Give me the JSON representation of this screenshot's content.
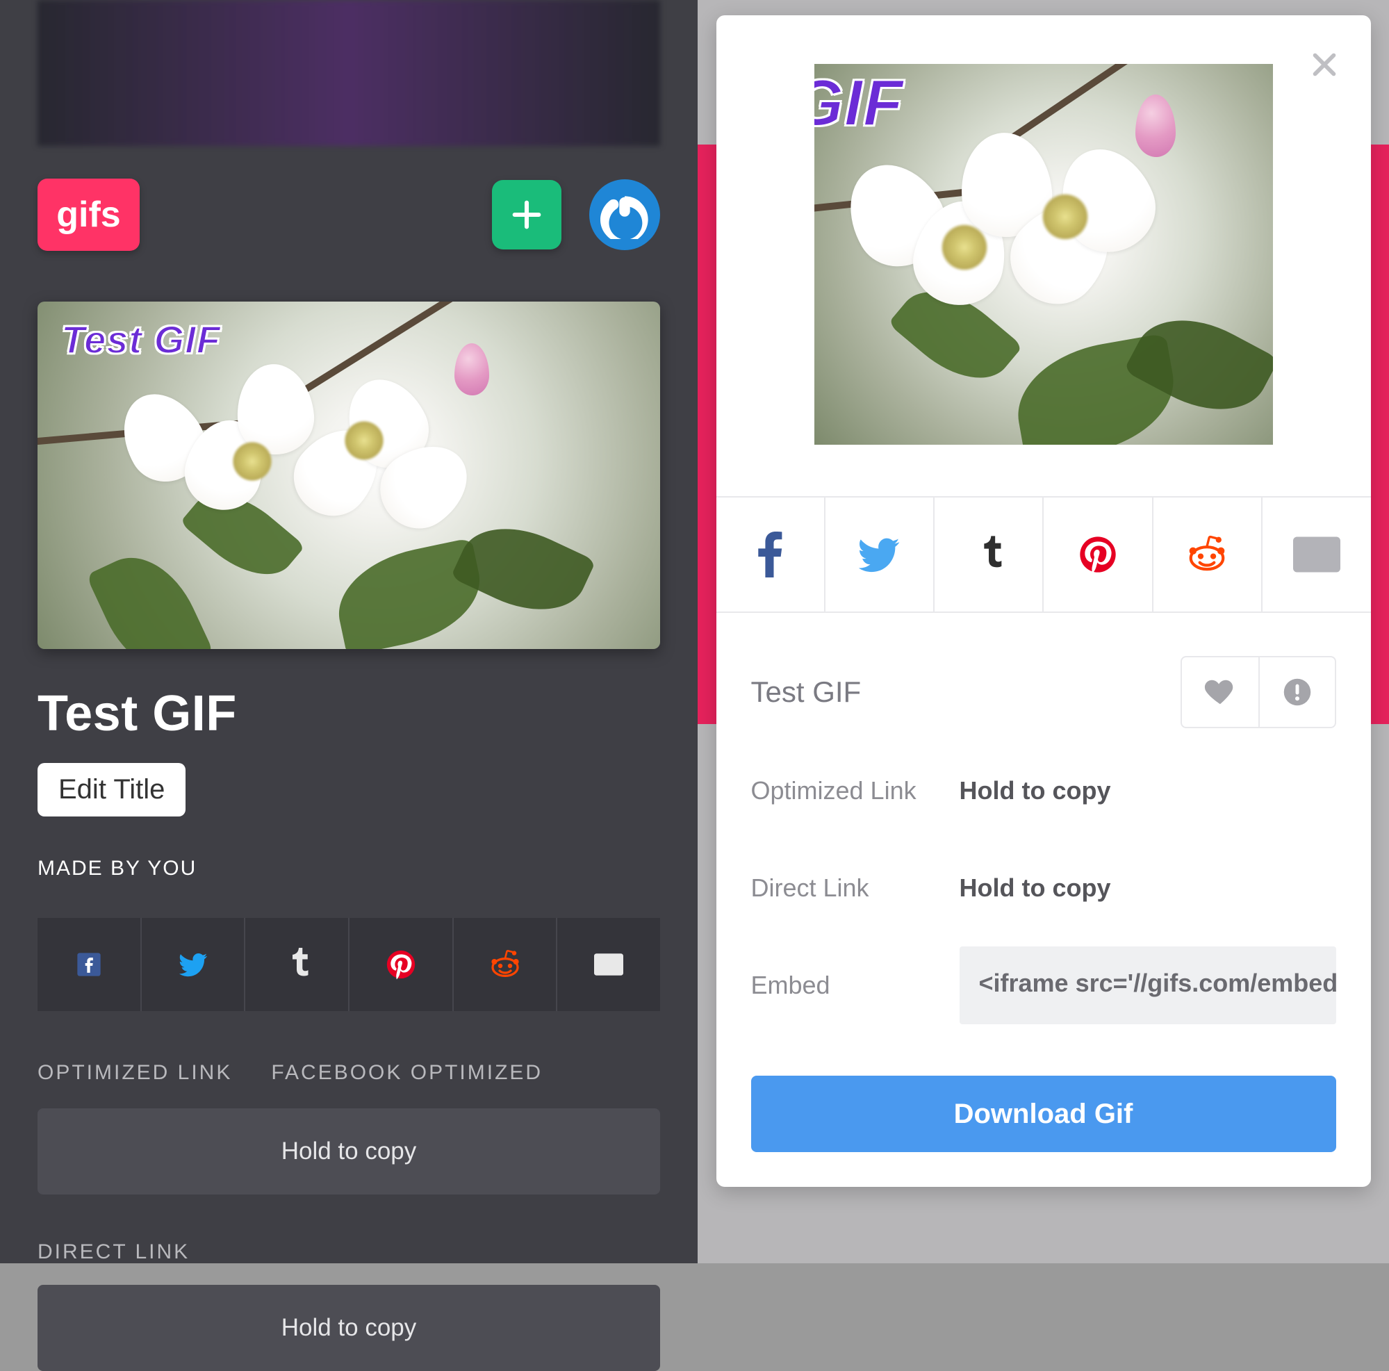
{
  "brand": {
    "logo_text": "gifs"
  },
  "gif": {
    "overlay_text": "Test GIF",
    "overlay_text_cropped": "t GIF",
    "title": "Test GIF",
    "edit_title_label": "Edit Title",
    "made_by_label": "MADE BY YOU"
  },
  "share_targets": [
    "facebook",
    "twitter",
    "tumblr",
    "pinterest",
    "reddit",
    "email"
  ],
  "left_links": {
    "optimized_label": "OPTIMIZED LINK",
    "facebook_optimized_label": "FACEBOOK OPTIMIZED",
    "direct_label": "DIRECT LINK",
    "hold_to_copy": "Hold to copy"
  },
  "modal": {
    "title": "Test GIF",
    "optimized_label": "Optimized Link",
    "direct_label": "Direct Link",
    "embed_label": "Embed",
    "hold_to_copy": "Hold to copy",
    "embed_value": "<iframe src='//gifs.com/embed",
    "download_label": "Download Gif"
  }
}
